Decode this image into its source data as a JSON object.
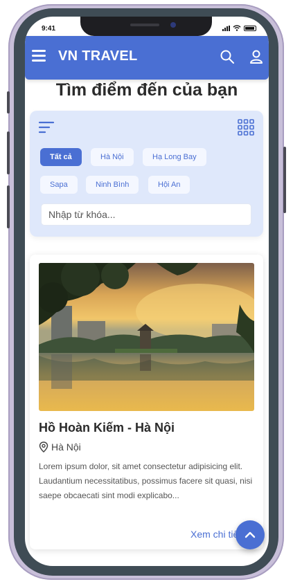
{
  "status_bar": {
    "time": "9:41"
  },
  "header": {
    "brand": "VN TRAVEL",
    "icons": {
      "menu": "menu-icon",
      "search": "search-icon",
      "user": "user-icon"
    },
    "accent_color": "#4a6fd3"
  },
  "page": {
    "title": "Tìm điểm đến của bạn"
  },
  "filter": {
    "icons": {
      "left": "filter-lines-icon",
      "right": "grid-icon"
    },
    "chips": [
      {
        "label": "Tất cả",
        "active": true
      },
      {
        "label": "Hà Nội",
        "active": false
      },
      {
        "label": "Hạ Long Bay",
        "active": false
      },
      {
        "label": "Sapa",
        "active": false
      },
      {
        "label": "Ninh Bình",
        "active": false
      },
      {
        "label": "Hội An",
        "active": false
      }
    ],
    "search_placeholder": "Nhập từ khóa...",
    "panel_color": "#dfe8fb"
  },
  "card": {
    "image_icon": "lake-landscape-image",
    "title": "Hồ Hoàn Kiếm - Hà Nội",
    "location": "Hà Nội",
    "location_icon": "map-pin-icon",
    "description": "Lorem ipsum dolor, sit amet consectetur adipisicing elit. Laudantium necessitatibus, possimus facere sit quasi, nisi saepe obcaecati sint modi explicabo...",
    "link": "Xem chi tiết"
  },
  "scroll_top": {
    "icon": "chevron-up-icon"
  }
}
